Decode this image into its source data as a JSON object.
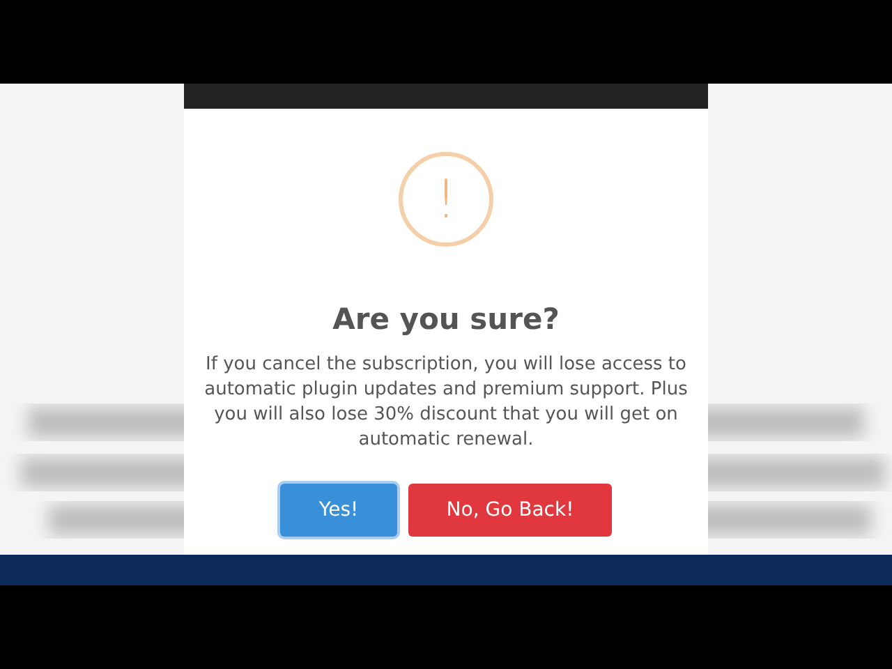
{
  "dialog": {
    "icon": "!",
    "title": "Are you sure?",
    "message": "If you cancel the subscription, you will lose access to automatic plugin updates and premium support. Plus you will also lose 30% discount that you will get on automatic renewal.",
    "buttons": [
      {
        "label": "Yes!",
        "kind": "confirm"
      },
      {
        "label": "No, Go Back!",
        "kind": "cancel"
      }
    ]
  }
}
